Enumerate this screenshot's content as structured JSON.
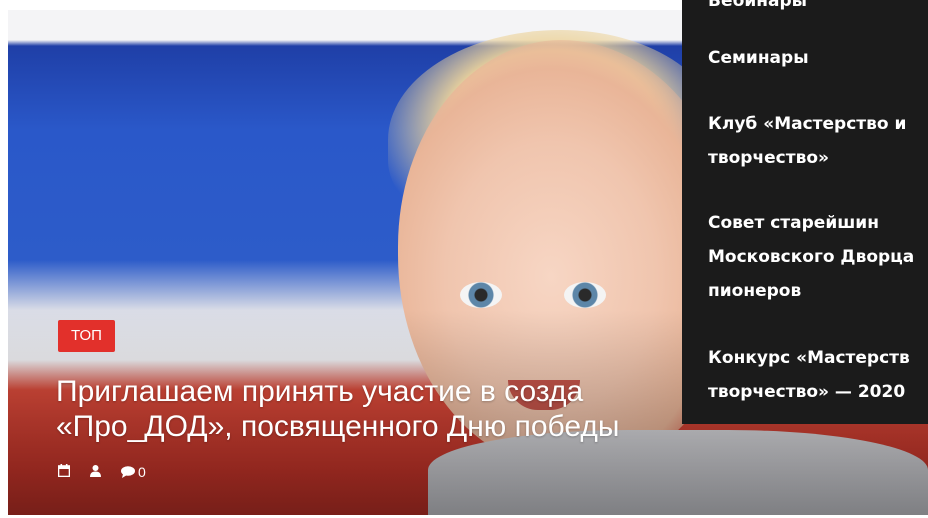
{
  "hero": {
    "badge": "ТОП",
    "headline_line1": "Приглашаем принять участие в созда",
    "headline_line2": "«Про_ДОД», посвященного Дню победы",
    "comment_count": "0"
  },
  "dropdown": {
    "items": [
      {
        "label": "Вебинары"
      },
      {
        "label": "Семинары"
      },
      {
        "label_line1": "Клуб «Мастерство и",
        "label_line2": "творчество»"
      },
      {
        "label_line1": "Совет старейшин",
        "label_line2": "Московского Дворца",
        "label_line3": "пионеров"
      },
      {
        "label_line1": "Конкурс «Мастерств",
        "label_line2": "творчество» — 2020"
      }
    ]
  },
  "colors": {
    "badge_bg": "#e2302b",
    "dropdown_bg": "#1b1b1b"
  }
}
